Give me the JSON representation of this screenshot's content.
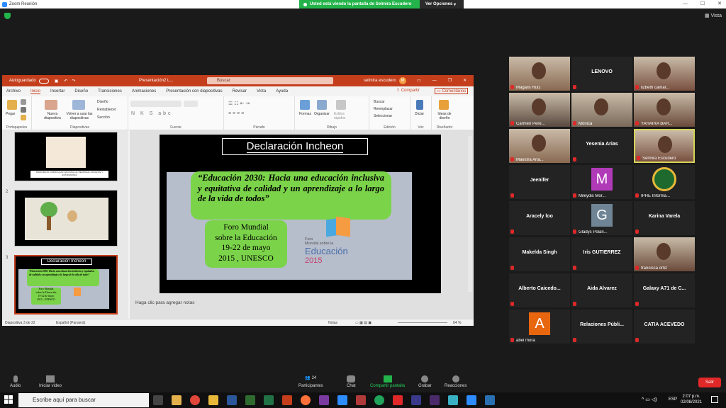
{
  "zoom": {
    "window_title": "Zoom Reunión",
    "share_banner": "Usted está viendo la pantalla de Selmira Escudero",
    "view_options": "Ver Opciones",
    "view_label": "Vista"
  },
  "ppt": {
    "autosave": "Autoguardado",
    "filename": "Presentación2 L...",
    "search_placeholder": "Buscar",
    "user": "selmira escudero",
    "avatar_initial": "M",
    "tabs": [
      "Archivo",
      "Inicio",
      "Insertar",
      "Diseño",
      "Transiciones",
      "Animaciones",
      "Presentación con diapositivas",
      "Revisar",
      "Vista",
      "Ayuda"
    ],
    "share": "Compartir",
    "comments": "Comentarios",
    "ribbon": {
      "paste": "Pegar",
      "clipboard": "Portapapeles",
      "new_slide": "Nueva diapositiva",
      "reuse": "Volver a usar las diapositivas",
      "layout": "Diseño",
      "reset": "Restablecer",
      "section": "Sección",
      "slides_group": "Diapositivas",
      "font_group": "Fuente",
      "paragraph_group": "Párrafo",
      "shapes": "Formas",
      "arrange": "Organizar",
      "quick_styles": "Estilos rápidos",
      "drawing_group": "Dibujo",
      "find": "Buscar",
      "replace": "Reemplazar",
      "select": "Seleccionar",
      "editing_group": "Edición",
      "dictate": "Dictar",
      "voice_group": "Voz",
      "designer": "Ideas de diseño",
      "designer_group": "Diseñador"
    },
    "slide_numbers": [
      "2",
      "3"
    ],
    "thumb1_text": "PROPUESTA CURRICULAR NACIONAL AL PERSONAL DOCENTE Y ESTUDIANTES",
    "slide": {
      "title": "Declaración Incheon",
      "quote": "“Educación 2030: Hacia una educación inclusiva y equitativa de calidad y un aprendizaje a lo largo de la vida de todos”",
      "forum": [
        "Foro Mundial",
        "sobre la Educación",
        "19-22 de mayo",
        "2015 , UNESCO"
      ],
      "logo_lines": [
        "Foro",
        "Mundial sobre la",
        "Educación",
        "2015"
      ]
    },
    "notes_placeholder": "Haga clic para agregar notas",
    "status": {
      "slide_count": "Diapositiva 3 de 22",
      "language": "Español (Panamá)",
      "notes": "Notas",
      "zoom": "64 %"
    }
  },
  "participants": [
    {
      "name": "Magalis Ruiz",
      "type": "video"
    },
    {
      "name": "LENOVO",
      "type": "name"
    },
    {
      "name": "lizbeth camar...",
      "type": "video"
    },
    {
      "name": "Carmen Pere...",
      "type": "video"
    },
    {
      "name": "Mónica",
      "type": "video"
    },
    {
      "name": "YAHAIRA BÁR...",
      "type": "video"
    },
    {
      "name": "Maestra Ana...",
      "type": "video"
    },
    {
      "name": "Yesenia Arias",
      "type": "name"
    },
    {
      "name": "Selmira Escudero",
      "type": "video"
    },
    {
      "name": "Jeenifer",
      "type": "name"
    },
    {
      "name": "Mileydis Mor...",
      "type": "letter",
      "letter": "M",
      "color": "#b03ab8"
    },
    {
      "name": "IPHE Informa...",
      "type": "logo"
    },
    {
      "name": "Aracely loo",
      "type": "name"
    },
    {
      "name": "Gladys Polan...",
      "type": "letter",
      "letter": "G",
      "color": "#6f8595"
    },
    {
      "name": "Karina Varela",
      "type": "name"
    },
    {
      "name": "Makelda Singh",
      "type": "name"
    },
    {
      "name": "Iris GUTIERREZ",
      "type": "name"
    },
    {
      "name": "francisca ortiz",
      "type": "video"
    },
    {
      "name": "Alberto  Caicedo...",
      "type": "name"
    },
    {
      "name": "Aida Alvarez",
      "type": "name"
    },
    {
      "name": "Galaxy A71 de C...",
      "type": "name"
    },
    {
      "name": "abel mora",
      "type": "letter",
      "letter": "A",
      "color": "#e8660e"
    },
    {
      "name": "Relaciones  Públi...",
      "type": "name"
    },
    {
      "name": "CATIA ACEVEDO",
      "type": "name"
    }
  ],
  "toolbar": {
    "audio": "Audio",
    "video": "Iniciar video",
    "participants": "Participantes",
    "participants_count": "24",
    "chat": "Chat",
    "share": "Compartir pantalla",
    "record": "Grabar",
    "reactions": "Reacciones",
    "leave": "Salir"
  },
  "taskbar": {
    "search": "Escribe aquí para buscar",
    "lang": "ESP",
    "time": "2:07 p.m.",
    "date": "02/08/2021"
  },
  "colors": {
    "ppt_red": "#c43e1c",
    "zoom_green": "#23b34a",
    "slide_green": "#7bd34a",
    "leave_red": "#e02828"
  }
}
